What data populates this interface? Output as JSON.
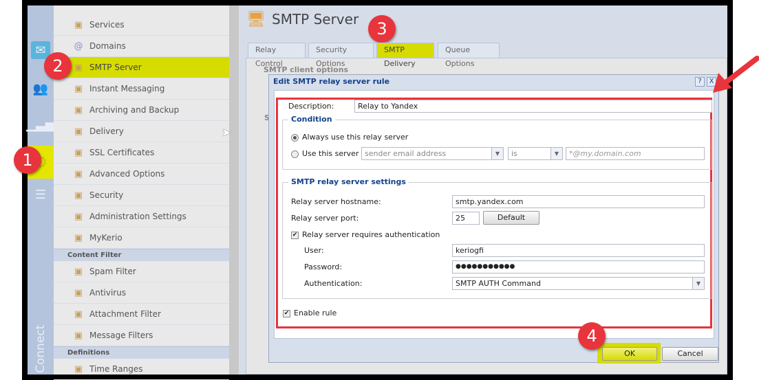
{
  "colors": {
    "accent_highlight": "#d6dc00",
    "annotation_red": "#e8343c",
    "title_blue": "#15428b"
  },
  "app": {
    "brand": "Connect",
    "page_title": "SMTP Server"
  },
  "strip_icons": [
    "mail-icon",
    "users-icon",
    "stats-icon",
    "gear-icon",
    "logs-icon"
  ],
  "nav": {
    "items": [
      {
        "label": "Services",
        "icon": "services-icon"
      },
      {
        "label": "Domains",
        "icon": "at-icon"
      },
      {
        "label": "SMTP Server",
        "icon": "smtp-icon",
        "active": true
      },
      {
        "label": "Instant Messaging",
        "icon": "chat-icon"
      },
      {
        "label": "Archiving and Backup",
        "icon": "archive-icon"
      },
      {
        "label": "Delivery",
        "icon": "delivery-icon"
      },
      {
        "label": "SSL Certificates",
        "icon": "certificate-icon"
      },
      {
        "label": "Advanced Options",
        "icon": "gears-icon"
      },
      {
        "label": "Security",
        "icon": "hand-icon"
      },
      {
        "label": "Administration Settings",
        "icon": "admin-icon"
      },
      {
        "label": "MyKerio",
        "icon": "mykerio-icon"
      }
    ],
    "section_content": "Content Filter",
    "content_items": [
      {
        "label": "Spam Filter",
        "icon": "spam-icon"
      },
      {
        "label": "Antivirus",
        "icon": "antivirus-icon"
      },
      {
        "label": "Attachment Filter",
        "icon": "attachment-icon"
      },
      {
        "label": "Message Filters",
        "icon": "filter-icon"
      }
    ],
    "section_definitions": "Definitions",
    "definition_items": [
      {
        "label": "Time Ranges",
        "icon": "clock-icon"
      }
    ]
  },
  "tabs": [
    {
      "label": "Relay Control"
    },
    {
      "label": "Security Options"
    },
    {
      "label": "SMTP Delivery",
      "active": true
    },
    {
      "label": "Queue Options"
    }
  ],
  "panel": {
    "section1": "SMTP client options",
    "section2": "S"
  },
  "dialog": {
    "title": "Edit SMTP relay server rule",
    "help": "?",
    "close": "X",
    "description_label": "Description:",
    "description_value": "Relay to Yandex",
    "condition_legend": "Condition",
    "radio_always": "Always use this relay server",
    "radio_if": "Use this server if",
    "cond_field": "sender email address",
    "cond_op": "is",
    "cond_placeholder": "*@my.domain.com",
    "settings_legend": "SMTP relay server settings",
    "hostname_label": "Relay server hostname:",
    "hostname_value": "smtp.yandex.com",
    "port_label": "Relay server port:",
    "port_value": "25",
    "default_button": "Default",
    "auth_required": "Relay server requires authentication",
    "user_label": "User:",
    "user_value": "keriogfi",
    "password_label": "Password:",
    "password_value": "●●●●●●●●●●●",
    "auth_label": "Authentication:",
    "auth_value": "SMTP AUTH Command",
    "enable_rule": "Enable rule",
    "ok": "OK",
    "cancel": "Cancel"
  },
  "annotations": [
    "1",
    "2",
    "3",
    "4"
  ]
}
